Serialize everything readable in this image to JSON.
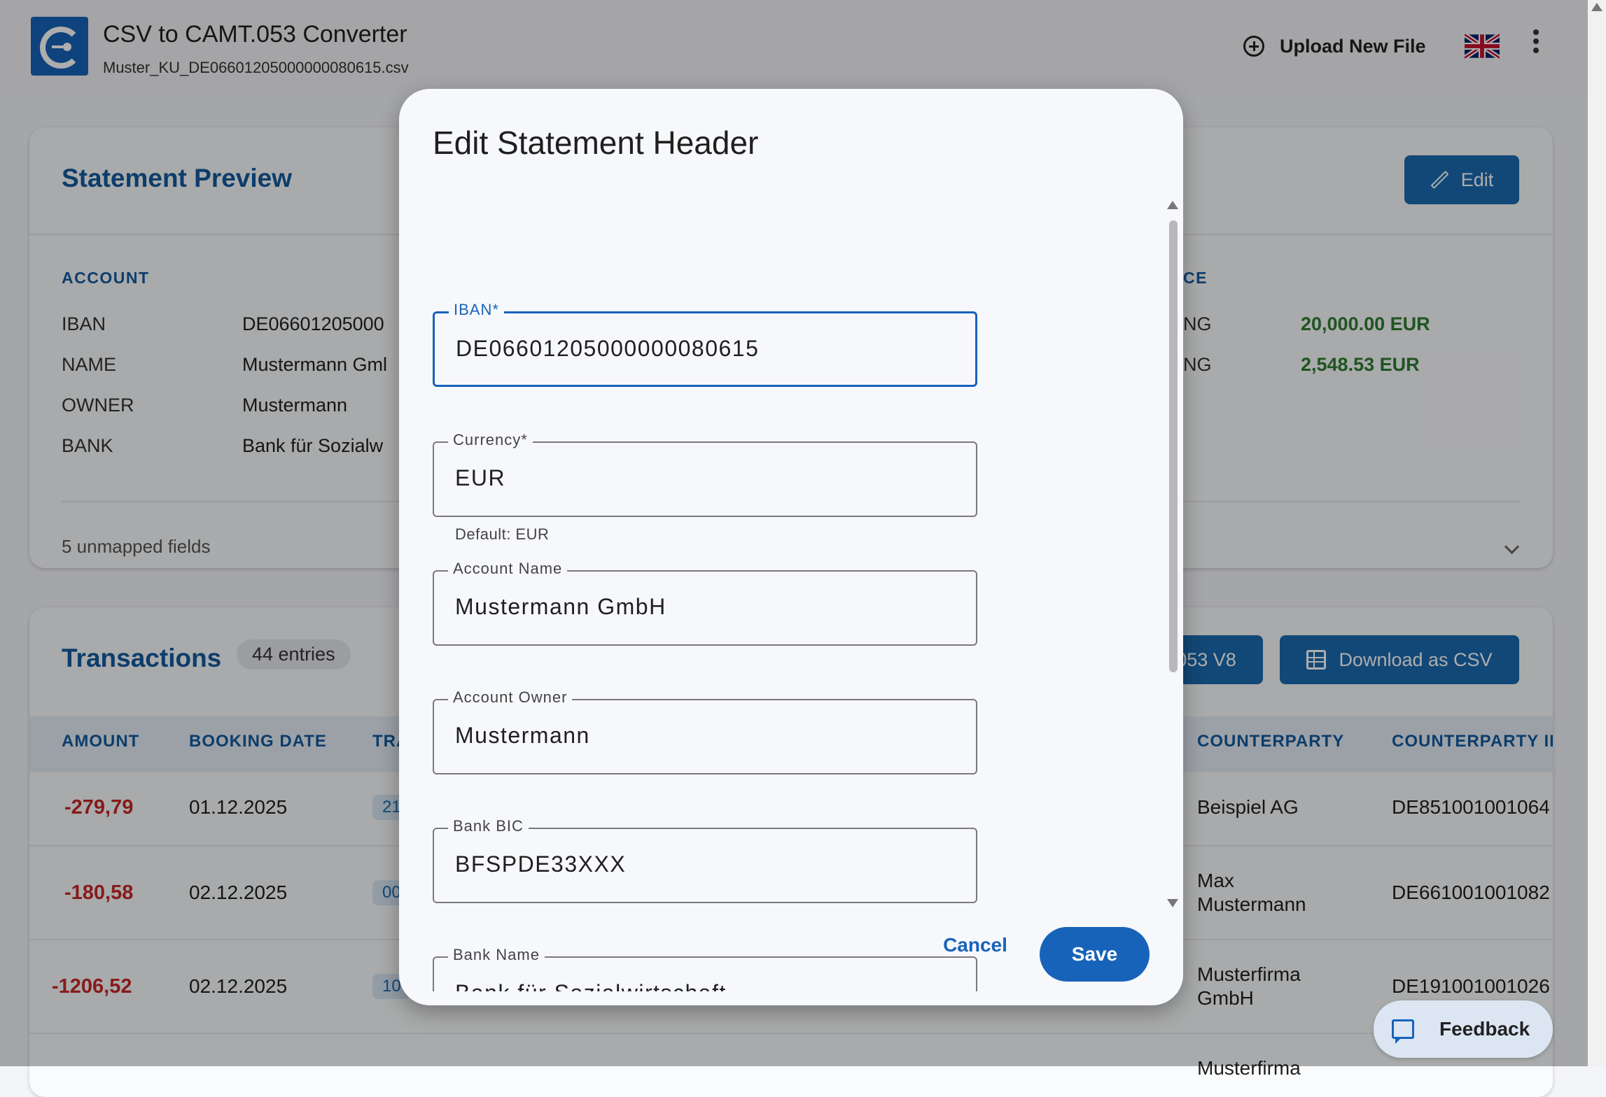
{
  "app": {
    "title": "CSV to CAMT.053 Converter",
    "filename": "Muster_KU_DE06601205000000080615.csv",
    "upload_label": "Upload New File",
    "language_flag": "uk-flag-icon"
  },
  "statement": {
    "title": "Statement Preview",
    "edit_label": "Edit",
    "account_section": "ACCOUNT",
    "balance_section_partial": "CE",
    "fields": [
      {
        "key": "IBAN",
        "value": "DE06601205000"
      },
      {
        "key": "NAME",
        "value": "Mustermann Gml"
      },
      {
        "key": "OWNER",
        "value": "Mustermann"
      },
      {
        "key": "BANK",
        "value": "Bank für Sozialw"
      }
    ],
    "balances": [
      {
        "key": "NG",
        "value": "20,000.00 EUR"
      },
      {
        "key": "NG",
        "value": "2,548.53 EUR"
      }
    ],
    "unmapped": "5 unmapped fields"
  },
  "transactions": {
    "title": "Transactions",
    "count": "44 entries",
    "export_partial": "053 V8",
    "download_csv": "Download as CSV",
    "columns": [
      "AMOUNT",
      "BOOKING DATE",
      "TRA",
      "COUNTERPARTY",
      "COUNTERPARTY II"
    ],
    "rows": [
      {
        "amount": "-279,79",
        "date": "01.12.2025",
        "code": "21",
        "counterparty": "Beispiel AG",
        "counterparty_iban": "DE851001001064"
      },
      {
        "amount": "-180,58",
        "date": "02.12.2025",
        "code": "00",
        "counterparty": "Max Mustermann",
        "counterparty_iban": "DE661001001082"
      },
      {
        "amount": "-1206,52",
        "date": "02.12.2025",
        "code": "10",
        "counterparty": "Musterfirma GmbH",
        "counterparty_iban": "DE191001001026"
      },
      {
        "amount": "",
        "date": "",
        "code": "",
        "counterparty": "Musterfirma",
        "counterparty_iban": ""
      }
    ]
  },
  "dialog": {
    "title": "Edit Statement Header",
    "fields": [
      {
        "label": "IBAN*",
        "value": "DE06601205000000080615"
      },
      {
        "label": "Currency*",
        "value": "EUR",
        "helper": "Default: EUR"
      },
      {
        "label": "Account Name",
        "value": "Mustermann GmbH"
      },
      {
        "label": "Account Owner",
        "value": "Mustermann"
      },
      {
        "label": "Bank BIC",
        "value": "BFSPDE33XXX"
      },
      {
        "label": "Bank Name",
        "value": "Bank für Sozialwirtschaft"
      }
    ],
    "cancel_label": "Cancel",
    "save_label": "Save"
  },
  "feedback_label": "Feedback",
  "colors": {
    "primary": "#1763b9",
    "heading": "#135b9e",
    "negative": "#c62828",
    "positive": "#2e7d32"
  }
}
